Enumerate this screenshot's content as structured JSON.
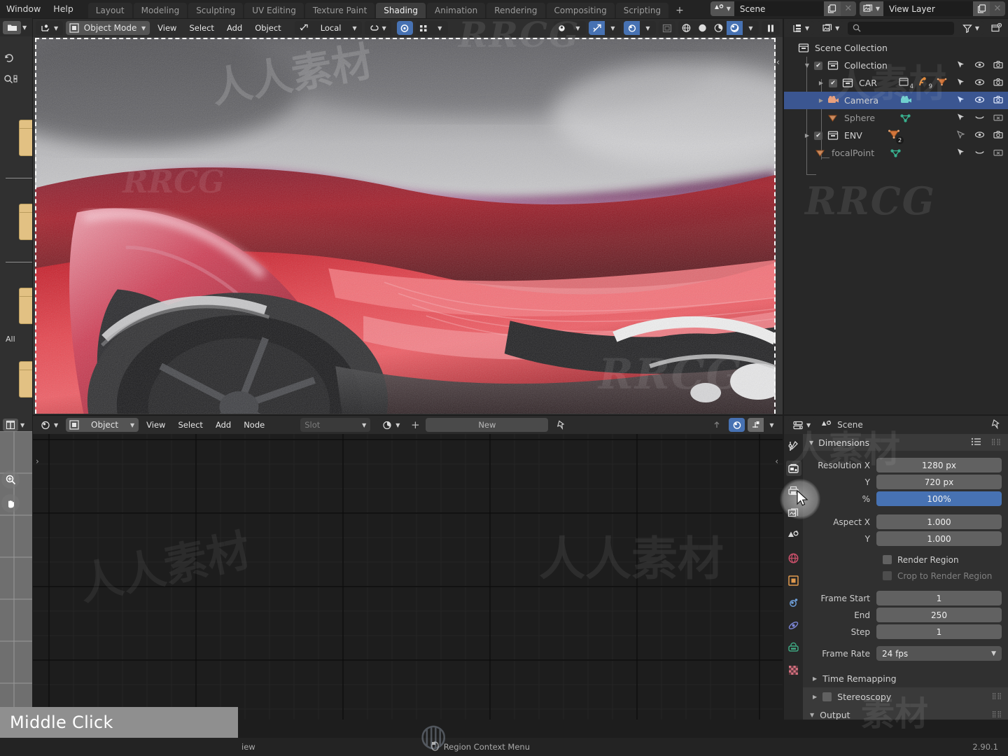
{
  "topbar": {
    "menus": [
      "Window",
      "Help"
    ],
    "workspaces": [
      {
        "label": "Layout",
        "active": false
      },
      {
        "label": "Modeling",
        "active": false
      },
      {
        "label": "Sculpting",
        "active": false
      },
      {
        "label": "UV Editing",
        "active": false
      },
      {
        "label": "Texture Paint",
        "active": false
      },
      {
        "label": "Shading",
        "active": true
      },
      {
        "label": "Animation",
        "active": false
      },
      {
        "label": "Rendering",
        "active": false
      },
      {
        "label": "Compositing",
        "active": false
      },
      {
        "label": "Scripting",
        "active": false
      }
    ],
    "add_workspace": "+",
    "scene_name": "Scene",
    "view_layer_name": "View Layer"
  },
  "viewport": {
    "mode": "Object Mode",
    "menus": [
      "View",
      "Select",
      "Add",
      "Object"
    ],
    "transform_orientation": "Local",
    "shading_modes": [
      "wireframe",
      "solid",
      "material-preview",
      "rendered"
    ],
    "active_shading": "rendered"
  },
  "outliner": {
    "search_placeholder": "",
    "rows": [
      {
        "name": "Scene Collection",
        "indent": 0,
        "icon": "collection-icon",
        "checkbox": false,
        "dim": false,
        "selected": false,
        "disclosure": "",
        "visibility": []
      },
      {
        "name": "Collection",
        "indent": 1,
        "icon": "collection-icon",
        "checkbox": true,
        "dim": false,
        "selected": false,
        "disclosure": "down",
        "visibility": [
          "select",
          "eye",
          "camera"
        ]
      },
      {
        "name": "CAR",
        "indent": 2,
        "icon": "collection-icon",
        "checkbox": true,
        "dim": false,
        "selected": false,
        "disclosure": "right",
        "visibility": [
          "select",
          "eye",
          "camera"
        ],
        "counts": [
          {
            "icon": "collection-icon",
            "n": "4"
          },
          {
            "icon": "mesh-data-icon",
            "n": "9"
          },
          {
            "icon": "mesh-tri-icon",
            "n": ""
          }
        ]
      },
      {
        "name": "Camera",
        "indent": 2,
        "icon": "camera-data-icon",
        "checkbox": false,
        "dim": false,
        "selected": true,
        "disclosure": "right",
        "visibility": [
          "select",
          "eye",
          "camera"
        ]
      },
      {
        "name": "Sphere",
        "indent": 2,
        "icon": "mesh-tri-icon",
        "checkbox": false,
        "dim": true,
        "selected": false,
        "disclosure": "",
        "visibility": [
          "select",
          "eye-closed",
          "camera-off"
        ]
      },
      {
        "name": "ENV",
        "indent": 1,
        "icon": "collection-icon",
        "checkbox": true,
        "dim": false,
        "selected": false,
        "disclosure": "right",
        "visibility": [
          "select-off",
          "eye",
          "camera"
        ],
        "counts": [
          {
            "icon": "mesh-tri-icon",
            "n": "2"
          }
        ]
      },
      {
        "name": "focalPoint",
        "indent": 1,
        "icon": "mesh-tri-icon",
        "checkbox": false,
        "dim": true,
        "selected": false,
        "disclosure": "",
        "visibility": [
          "select",
          "eye-closed",
          "camera-off"
        ]
      }
    ]
  },
  "shader_editor": {
    "type": "Object",
    "menus": [
      "View",
      "Select",
      "Add",
      "Node"
    ],
    "slot_placeholder": "Slot",
    "new_button": "New"
  },
  "properties": {
    "context_name": "Scene",
    "panel_title": "Dimensions",
    "fields": [
      {
        "label": "Resolution X",
        "value": "1280 px",
        "accent": false
      },
      {
        "label": "Y",
        "value": "720 px",
        "accent": false
      },
      {
        "label": "%",
        "value": "100%",
        "accent": true
      }
    ],
    "aspect": [
      {
        "label": "Aspect X",
        "value": "1.000"
      },
      {
        "label": "Y",
        "value": "1.000"
      }
    ],
    "checkboxes": [
      {
        "label": "Render Region",
        "checked": false,
        "disabled": false
      },
      {
        "label": "Crop to Render Region",
        "checked": false,
        "disabled": true
      }
    ],
    "frames": [
      {
        "label": "Frame Start",
        "value": "1"
      },
      {
        "label": "End",
        "value": "250"
      },
      {
        "label": "Step",
        "value": "1"
      }
    ],
    "frame_rate": {
      "label": "Frame Rate",
      "value": "24 fps"
    },
    "subpanels": [
      {
        "label": "Time Remapping",
        "open": false,
        "checkbox": false,
        "grip": false
      },
      {
        "label": "Stereoscopy",
        "open": false,
        "checkbox": true,
        "grip": true
      },
      {
        "label": "Output",
        "open": true,
        "checkbox": false,
        "grip": true
      }
    ],
    "tabs": [
      "tool-icon",
      "render-icon",
      "output-icon",
      "view-layer-icon",
      "scene-icon",
      "world-icon",
      "object-icon",
      "modifier-icon",
      "physics-icon",
      "constraint-icon",
      "object-data-icon",
      "material-icon"
    ],
    "active_tab_index": 1
  },
  "statusbar": {
    "hint_mouse": "mouse-icon",
    "hint_partial": "iew",
    "context_menu": "Region Context Menu",
    "version": "2.90.1"
  },
  "overlay": {
    "tooltip": "Middle Click"
  },
  "leftstrip": {
    "label": "All"
  },
  "colors": {
    "accent_blue": "#4772b3",
    "selection_blue": "#3b5691",
    "panel_bg": "#303030",
    "header_bg": "#2b2b2b",
    "editor_bg": "#1d1d1d",
    "field_bg": "#616161",
    "tooltip_bg": "#8f8f8f",
    "car_red": "#b4141c"
  }
}
